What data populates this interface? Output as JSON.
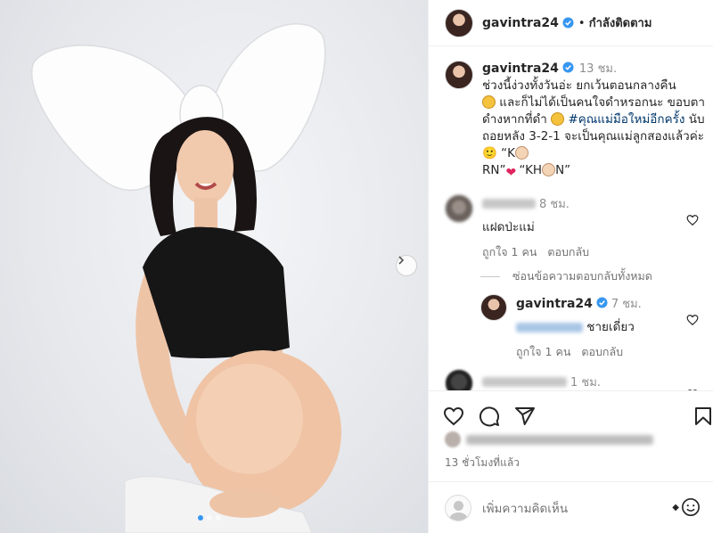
{
  "post": {
    "username": "gavintra24",
    "follow_status": "กำลังติดตาม",
    "caption_time": "13 ชม.",
    "caption_part1": "ช่วงนี้ง่วงทั้งวันอ่ะ ยกเว้นตอนกลางคืน",
    "caption_part2": "และก็ไม่ได้เป็นคนใจดำหรอกนะ ขอบตาดำงหากที่ดำ",
    "hashtag": "#คุณแม่มือใหม่อีกครั้ง",
    "caption_part3": "นับถอยหลัง 3-2-1 จะเป็นคุณแม่ลูกสองแล้วค่ะ🙂 “K",
    "caption_part4": "RN”",
    "caption_part5": "“KH",
    "caption_part6": "N”",
    "post_time": "13 ชั่วโมงที่แล้ว"
  },
  "comments": [
    {
      "time": "8 ชม.",
      "text": "แฝดป่ะแม่",
      "like_count": "ถูกใจ 1 คน",
      "reply_label": "ตอบกลับ"
    }
  ],
  "hide_replies": "ซ่อนข้อความตอบกลับทั้งหมด",
  "reply": {
    "username": "gavintra24",
    "time": "7 ชม.",
    "text": "ชายเดี่ยว",
    "like_count": "ถูกใจ 1 คน",
    "reply_label": "ตอบกลับ"
  },
  "third_comment_time": "1 ชม.",
  "add_comment_placeholder": "เพิ่มความคิดเห็น",
  "carousel": {
    "slide_count": 3,
    "active_index": 0
  },
  "icons": [
    "verified-icon",
    "heart-icon",
    "comment-icon",
    "share-icon",
    "bookmark-icon",
    "next-icon",
    "emoji-icon"
  ],
  "colors": {
    "accent": "#3797f0",
    "hashtag": "#00376b",
    "text": "#262626",
    "muted": "#737373"
  }
}
